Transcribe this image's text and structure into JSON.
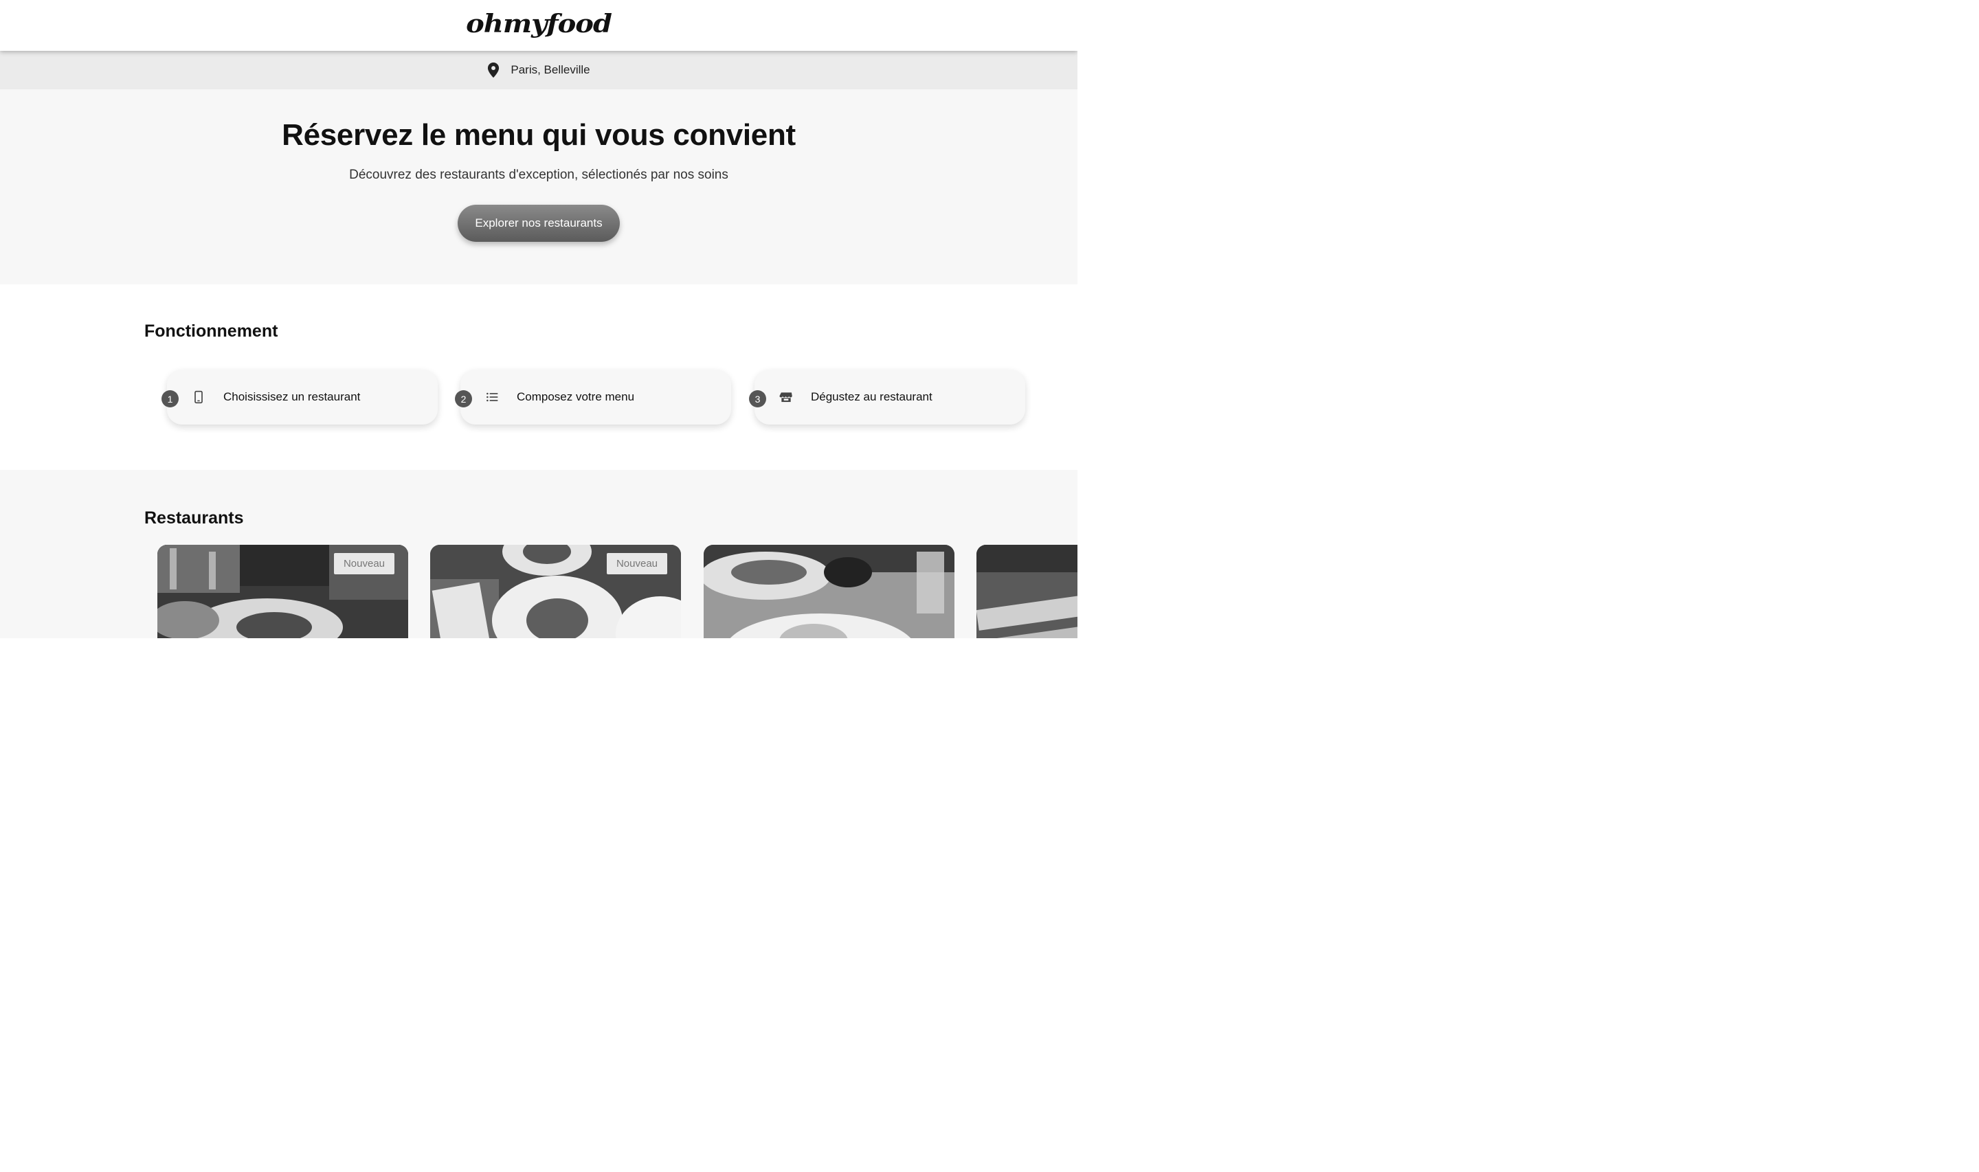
{
  "header": {
    "logo": "ohmyfood"
  },
  "location": {
    "icon": "map-pin-icon",
    "text": "Paris, Belleville"
  },
  "hero": {
    "title": "Réservez le menu qui vous convient",
    "subtitle": "Découvrez des restaurants d'exception, sélectionés par nos soins",
    "cta_label": "Explorer nos restaurants"
  },
  "howto": {
    "title": "Fonctionnement",
    "steps": [
      {
        "number": "1",
        "icon": "smartphone-icon",
        "label": "Choisissisez un restaurant"
      },
      {
        "number": "2",
        "icon": "list-icon",
        "label": "Composez votre menu"
      },
      {
        "number": "3",
        "icon": "store-icon",
        "label": "Dégustez au restaurant"
      }
    ]
  },
  "restaurants": {
    "title": "Restaurants",
    "cards": [
      {
        "badge": "Nouveau"
      },
      {
        "badge": "Nouveau"
      },
      {
        "badge": ""
      },
      {
        "badge": ""
      }
    ]
  },
  "colors": {
    "accent_gray": "#5b5b5b",
    "hero_bg": "#f7f7f7",
    "location_bg": "#ebebeb"
  }
}
